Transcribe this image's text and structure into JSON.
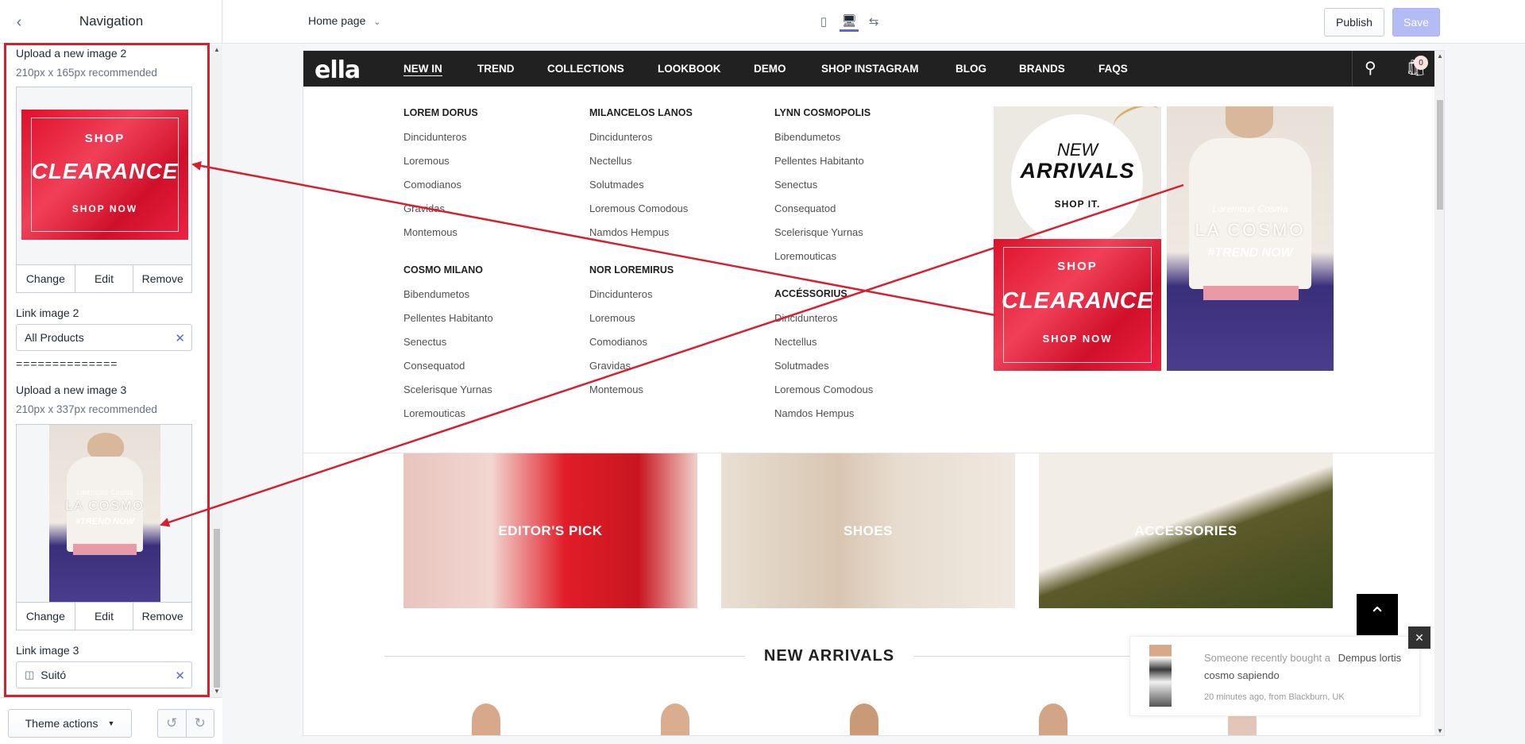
{
  "sidebar": {
    "title": "Navigation",
    "upload2": {
      "label": "Upload a new image 2",
      "hint": "210px x 165px recommended",
      "promo": {
        "line1": "SHOP",
        "line2": "CLEARANCE",
        "line3": "SHOP NOW"
      }
    },
    "buttons": {
      "change": "Change",
      "edit": "Edit",
      "remove": "Remove"
    },
    "link2": {
      "label": "Link image 2",
      "value": "All Products"
    },
    "divider": "==============",
    "upload3": {
      "label": "Upload a new image 3",
      "hint": "210px x 337px recommended",
      "promo": {
        "line1": "Loremous Cosma",
        "line2": "LA COSMO",
        "line3": "#TREND NOW"
      }
    },
    "link3": {
      "label": "Link image 3",
      "value": "Suitó"
    },
    "theme_actions": "Theme actions"
  },
  "topbar": {
    "page_select": "Home page",
    "publish": "Publish",
    "save": "Save"
  },
  "store": {
    "logo": "ella",
    "nav": [
      "NEW IN",
      "TREND",
      "COLLECTIONS",
      "LOOKBOOK",
      "DEMO",
      "SHOP INSTAGRAM",
      "BLOG",
      "BRANDS",
      "FAQS"
    ],
    "cart_count": "0",
    "menu": {
      "col1": {
        "heading1": "LOREM DORUS",
        "items1": [
          "Dincidunteros",
          "Loremous",
          "Comodianos",
          "Gravidas",
          "Montemous"
        ],
        "heading2": "COSMO MILANO",
        "items2": [
          "Bibendumetos",
          "Pellentes Habitanto",
          "Senectus",
          "Consequatod",
          "Scelerisque Yurnas",
          "Loremouticas"
        ]
      },
      "col2": {
        "heading1": "MILANCELOS LANOS",
        "items1": [
          "Dincidunteros",
          "Nectellus",
          "Solutmades",
          "Loremous Comodous",
          "Namdos Hempus"
        ],
        "heading2": "NOR LOREMIRUS",
        "items2": [
          "Dincidunteros",
          "Loremous",
          "Comodianos",
          "Gravidas",
          "Montemous"
        ]
      },
      "col3": {
        "heading1": "LYNN COSMOPOLIS",
        "items1": [
          "Bibendumetos",
          "Pellentes Habitanto",
          "Senectus",
          "Consequatod",
          "Scelerisque Yurnas",
          "Loremouticas"
        ],
        "heading2": "ACCÉSSORIUS",
        "items2": [
          "Dincidunteros",
          "Nectellus",
          "Solutmades",
          "Loremous Comodous",
          "Namdos Hempus"
        ]
      }
    },
    "promo_new": {
      "line1": "NEW",
      "line2": "ARRIVALS",
      "line3": "SHOP IT."
    },
    "promo_clearance": {
      "line1": "SHOP",
      "line2": "CLEARANCE",
      "line3": "SHOP NOW"
    },
    "promo_cosmo": {
      "line1": "Loremous Cosma",
      "line2": "LA COSMO",
      "line3": "#TREND NOW"
    },
    "categories": [
      "EDITOR'S PICK",
      "SHOES",
      "ACCESSORIES"
    ],
    "section_title": "NEW ARRIVALS",
    "notification": {
      "text1": "Someone recently bought a",
      "product": "Dempus lortis cosmo sapiendo",
      "meta": "20 minutes ago, from Blackburn, UK"
    }
  },
  "colors": {
    "annotation": "#d6202f",
    "nav_bg": "#212121",
    "accent": "#5c6ac4"
  }
}
